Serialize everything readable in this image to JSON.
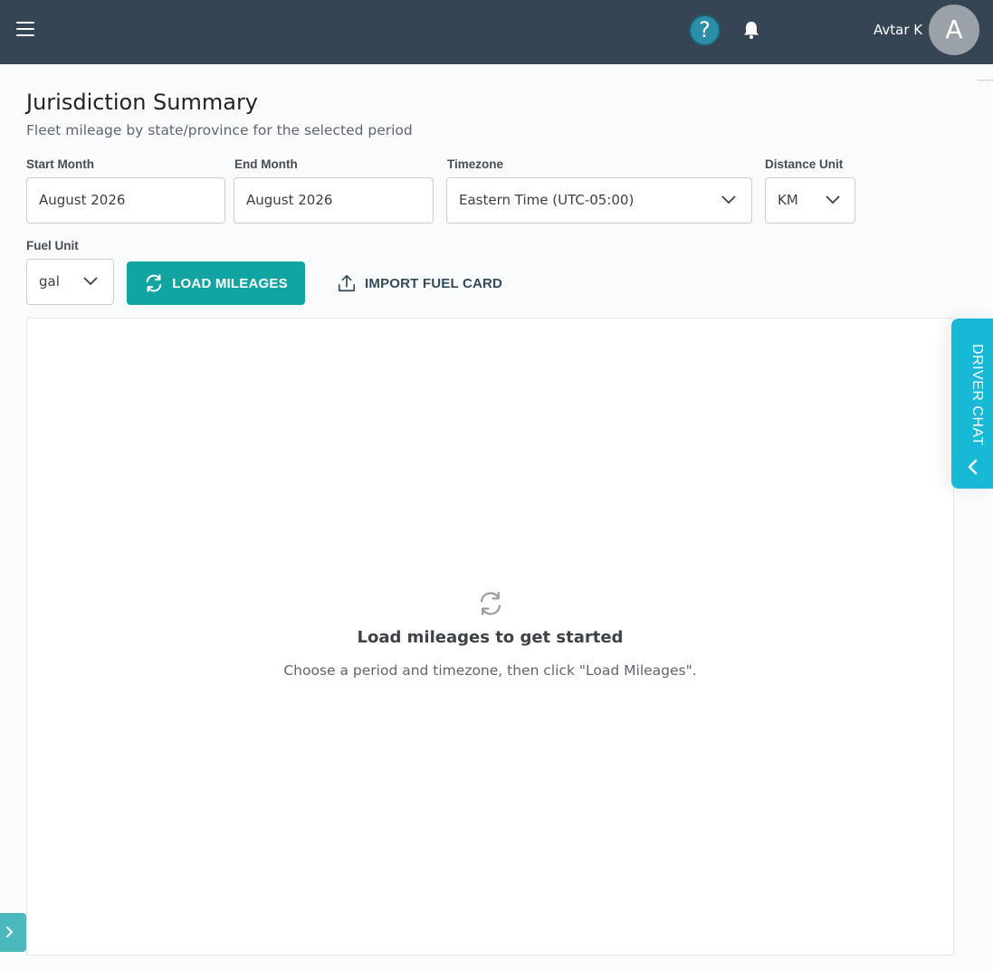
{
  "header": {
    "user_name": "Avtar K",
    "avatar_initial": "A",
    "help_glyph": "?"
  },
  "page": {
    "title": "Jurisdiction Summary",
    "subtitle": "Fleet mileage by state/province for the selected period"
  },
  "filters": {
    "start_month": {
      "label": "Start Month",
      "value": "August 2026"
    },
    "end_month": {
      "label": "End Month",
      "value": "August 2026"
    },
    "timezone": {
      "label": "Timezone",
      "value": "Eastern Time (UTC-05:00)"
    },
    "distance_unit": {
      "label": "Distance Unit",
      "value": "KM"
    },
    "fuel_unit": {
      "label": "Fuel Unit",
      "value": "gal"
    }
  },
  "actions": {
    "load_label": "LOAD MILEAGES",
    "import_label": "IMPORT FUEL CARD"
  },
  "empty_state": {
    "title": "Load mileages to get started",
    "message": "Choose a period and timezone, then click \"Load Mileages\"."
  },
  "driver_chat": {
    "label": "DRIVER CHAT"
  },
  "icons": {
    "menu": "menu-icon",
    "help": "help-icon",
    "bell": "bell-icon",
    "refresh": "refresh-icon",
    "upload": "upload-icon",
    "chevron_down": "chevron-down-icon",
    "chevron_left": "chevron-left-icon",
    "chevron_right": "chevron-right-icon"
  },
  "colors": {
    "topbar": "#364554",
    "primary_button": "#12a3a3",
    "driver_chat": "#18b9d6",
    "side_expand": "#4ab8bd"
  }
}
